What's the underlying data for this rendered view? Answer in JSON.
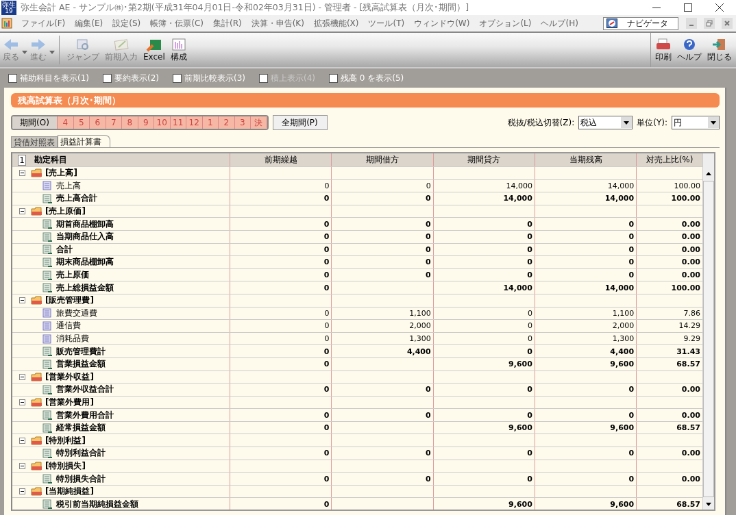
{
  "window": {
    "logo": "弥生",
    "logo_sub": "19",
    "title": "弥生会計 AE - サンプル㈱･第2期(平成31年04月01日-令和02年03月31日) - 管理者 - [残高試算表（月次･期間）]"
  },
  "menu": [
    "ファイル(F)",
    "編集(E)",
    "設定(S)",
    "帳簿・伝票(C)",
    "集計(R)",
    "決算・申告(K)",
    "拡張機能(X)",
    "ツール(T)",
    "ウィンドウ(W)",
    "オプション(L)",
    "ヘルプ(H)"
  ],
  "navigator": {
    "label": "ナビゲータ"
  },
  "toolbar": [
    {
      "label": "戻る",
      "kind": "back",
      "disabled": true,
      "dropdown": true
    },
    {
      "label": "進む",
      "kind": "forward",
      "disabled": true,
      "dropdown": true
    },
    {
      "label": "ジャンプ",
      "kind": "jump",
      "disabled": true,
      "dropdown": false
    },
    {
      "label": "前期入力",
      "kind": "prior",
      "disabled": true,
      "dropdown": false
    },
    {
      "label": "Excel",
      "kind": "excel",
      "disabled": false,
      "dropdown": false
    },
    {
      "label": "構成",
      "kind": "layout",
      "disabled": false,
      "dropdown": false
    }
  ],
  "toolbar_right": [
    {
      "label": "印刷",
      "kind": "print"
    },
    {
      "label": "ヘルプ",
      "kind": "help"
    },
    {
      "label": "閉じる",
      "kind": "close"
    }
  ],
  "options": [
    {
      "label": "補助科目を表示(1)",
      "checked": false,
      "disabled": false
    },
    {
      "label": "要約表示(2)",
      "checked": false,
      "disabled": false
    },
    {
      "label": "前期比較表示(3)",
      "checked": false,
      "disabled": false
    },
    {
      "label": "積上表示(4)",
      "checked": false,
      "disabled": true
    },
    {
      "label": "残高 0 を表示(5)",
      "checked": false,
      "disabled": false
    }
  ],
  "report_title": "残高試算表（月次･期間）",
  "period": {
    "label": "期間(O)",
    "months": [
      "4",
      "5",
      "6",
      "7",
      "8",
      "9",
      "10",
      "11",
      "12",
      "1",
      "2",
      "3",
      "決"
    ],
    "all_button": "全期間(P)"
  },
  "tax_toggle": {
    "label": "税抜/税込切替(Z):",
    "value": "税込"
  },
  "unit": {
    "label": "単位(Y):",
    "value": "円"
  },
  "tabs": [
    {
      "label": "貸借対照表",
      "selected": false
    },
    {
      "label": "損益計算書",
      "selected": true
    }
  ],
  "table": {
    "corner": "1",
    "columns": [
      "勘定科目",
      "前期繰越",
      "期間借方",
      "期間貸方",
      "当期残高",
      "対売上比(%)"
    ],
    "rows": [
      {
        "name": "[売上高]",
        "expanded": true,
        "children": [
          {
            "name": "売上高",
            "kind": "account",
            "values": [
              "0",
              "0",
              "14,000",
              "14,000",
              "100.00"
            ]
          },
          {
            "name": "売上高合計",
            "kind": "total",
            "values": [
              "0",
              "0",
              "14,000",
              "14,000",
              "100.00"
            ]
          }
        ]
      },
      {
        "name": "[売上原価]",
        "expanded": true,
        "children": [
          {
            "name": "期首商品棚卸高",
            "kind": "total",
            "values": [
              "0",
              "0",
              "0",
              "0",
              "0.00"
            ]
          },
          {
            "name": "当期商品仕入高",
            "kind": "total",
            "values": [
              "0",
              "0",
              "0",
              "0",
              "0.00"
            ]
          },
          {
            "name": "合計",
            "kind": "total",
            "values": [
              "0",
              "0",
              "0",
              "0",
              "0.00"
            ]
          },
          {
            "name": "期末商品棚卸高",
            "kind": "total",
            "values": [
              "0",
              "0",
              "0",
              "0",
              "0.00"
            ]
          },
          {
            "name": "売上原価",
            "kind": "total",
            "values": [
              "0",
              "0",
              "0",
              "0",
              "0.00"
            ]
          },
          {
            "name": "売上総損益金額",
            "kind": "total",
            "values": {
              "carried": "0",
              "credit": "14,000",
              "balance": "14,000",
              "ratio": "100.00"
            }
          }
        ]
      },
      {
        "name": "[販売管理費]",
        "expanded": true,
        "children": [
          {
            "name": "旅費交通費",
            "kind": "account",
            "values": [
              "0",
              "1,100",
              "0",
              "1,100",
              "7.86"
            ]
          },
          {
            "name": "通信費",
            "kind": "account",
            "values": [
              "0",
              "2,000",
              "0",
              "2,000",
              "14.29"
            ]
          },
          {
            "name": "消耗品費",
            "kind": "account",
            "values": [
              "0",
              "1,300",
              "0",
              "1,300",
              "9.29"
            ]
          },
          {
            "name": "販売管理費計",
            "kind": "total",
            "values": [
              "0",
              "4,400",
              "0",
              "4,400",
              "31.43"
            ]
          },
          {
            "name": "営業損益金額",
            "kind": "total",
            "values": {
              "carried": "0",
              "credit": "9,600",
              "balance": "9,600",
              "ratio": "68.57"
            }
          }
        ]
      },
      {
        "name": "[営業外収益]",
        "expanded": true,
        "children": [
          {
            "name": "営業外収益合計",
            "kind": "total",
            "values": [
              "0",
              "0",
              "0",
              "0",
              "0.00"
            ]
          }
        ]
      },
      {
        "name": "[営業外費用]",
        "expanded": true,
        "children": [
          {
            "name": "営業外費用合計",
            "kind": "total",
            "values": [
              "0",
              "0",
              "0",
              "0",
              "0.00"
            ]
          },
          {
            "name": "経常損益金額",
            "kind": "total",
            "values": {
              "carried": "0",
              "credit": "9,600",
              "balance": "9,600",
              "ratio": "68.57"
            }
          }
        ]
      },
      {
        "name": "[特別利益]",
        "expanded": true,
        "children": [
          {
            "name": "特別利益合計",
            "kind": "total",
            "values": [
              "0",
              "0",
              "0",
              "0",
              "0.00"
            ]
          }
        ]
      },
      {
        "name": "[特別損失]",
        "expanded": true,
        "children": [
          {
            "name": "特別損失合計",
            "kind": "total",
            "values": [
              "0",
              "0",
              "0",
              "0",
              "0.00"
            ]
          }
        ]
      },
      {
        "name": "[当期純損益]",
        "expanded": true,
        "children": [
          {
            "name": "税引前当期純損益金額",
            "kind": "total",
            "values": {
              "carried": "0",
              "credit": "9,600",
              "balance": "9,600",
              "ratio": "68.57"
            }
          }
        ]
      }
    ]
  }
}
